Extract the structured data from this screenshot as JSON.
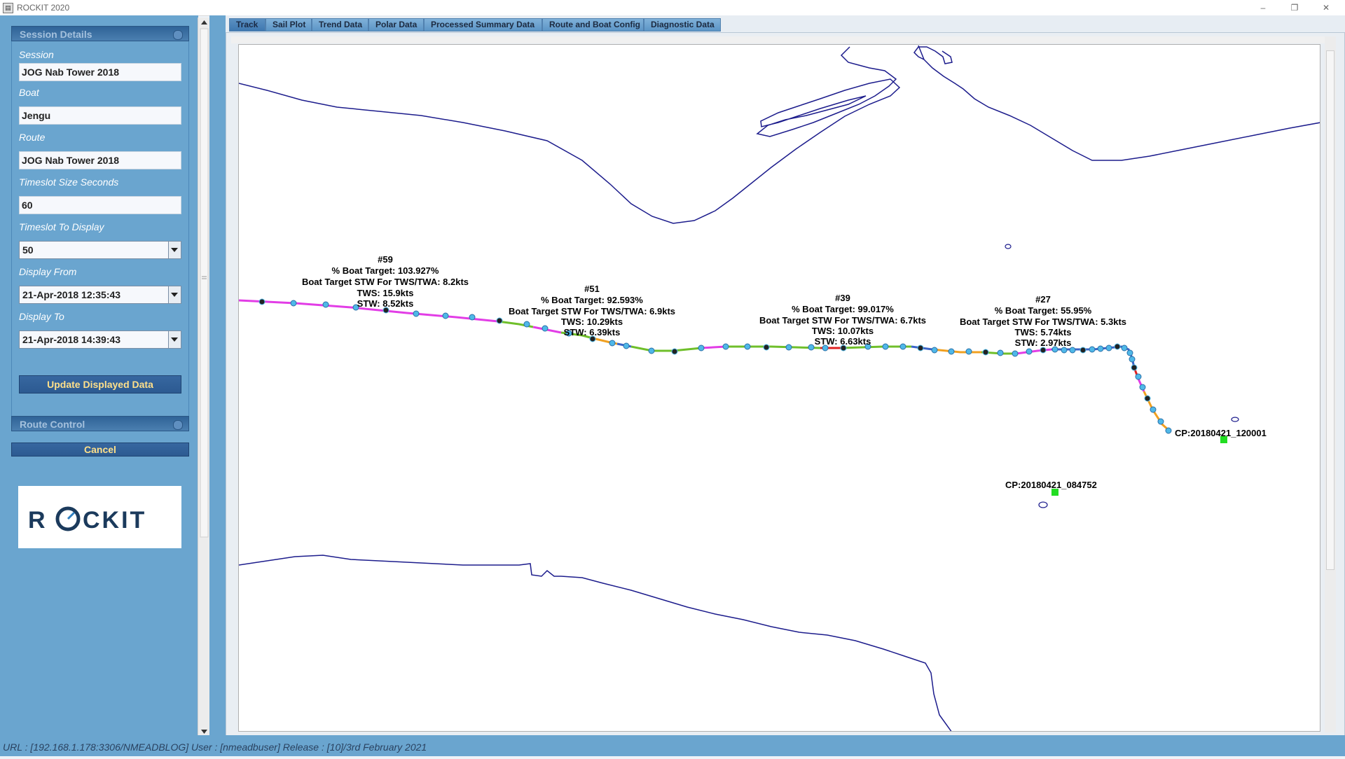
{
  "window": {
    "title": "ROCKIT 2020",
    "minimize": "–",
    "restore": "❐",
    "close": "✕"
  },
  "session_details": {
    "header": "Session Details",
    "session_label": "Session",
    "session_value": "JOG Nab Tower 2018",
    "boat_label": "Boat",
    "boat_value": "Jengu",
    "route_label": "Route",
    "route_value": "JOG Nab Tower 2018",
    "timeslot_size_label": "Timeslot Size Seconds",
    "timeslot_size_value": "60",
    "timeslot_display_label": "Timeslot To Display",
    "timeslot_display_value": "50",
    "display_from_label": "Display From",
    "display_from_value": "21-Apr-2018 12:35:43",
    "display_to_label": "Display To",
    "display_to_value": "21-Apr-2018 14:39:43",
    "update_button": "Update Displayed Data"
  },
  "route_control": {
    "header": "Route Control",
    "cancel_button": "Cancel"
  },
  "logo": {
    "text": "ROCKIT",
    "colors": {
      "primary": "#1b3a5c",
      "accent": "#2f7fc0"
    }
  },
  "tabs": [
    {
      "label": "Track"
    },
    {
      "label": "Sail Plot"
    },
    {
      "label": "Trend Data"
    },
    {
      "label": "Polar Data"
    },
    {
      "label": "Processed Summary Data"
    },
    {
      "label": "Route and Boat Config"
    },
    {
      "label": "Diagnostic Data"
    }
  ],
  "active_tab": "Track",
  "map": {
    "annotations": [
      {
        "id": "#59",
        "pct": "% Boat Target: 103.927%",
        "target": "Boat Target STW For TWS/TWA: 8.2kts",
        "tws": "TWS: 15.9kts",
        "stw": "STW: 8.52kts"
      },
      {
        "id": "#51",
        "pct": "% Boat Target: 92.593%",
        "target": "Boat Target STW For TWS/TWA: 6.9kts",
        "tws": "TWS: 10.29kts",
        "stw": "STW: 6.39kts"
      },
      {
        "id": "#39",
        "pct": "% Boat Target: 99.017%",
        "target": "Boat Target STW For TWS/TWA: 6.7kts",
        "tws": "TWS: 10.07kts",
        "stw": "STW: 6.63kts"
      },
      {
        "id": "#27",
        "pct": "% Boat Target: 55.95%",
        "target": "Boat Target STW For TWS/TWA: 5.3kts",
        "tws": "TWS: 5.74kts",
        "stw": "STW: 2.97kts"
      }
    ],
    "checkpoints": [
      {
        "label": "CP:20180421_120001"
      },
      {
        "label": "CP:20180421_084752"
      }
    ],
    "colors": {
      "coastline": "#1c1c8c",
      "checkpoint": "#22dd22",
      "track_magenta": "#e23de6",
      "track_green": "#6fbf2a",
      "track_blue": "#3a64c8",
      "track_orange": "#f0a020",
      "track_red": "#e02020",
      "marker": "#4fb8e8"
    }
  },
  "statusbar": {
    "text": "URL :  [192.168.1.178:3306/NMEADBLOG] User : [nmeadbuser] Release : [10]/3rd February 2021"
  }
}
